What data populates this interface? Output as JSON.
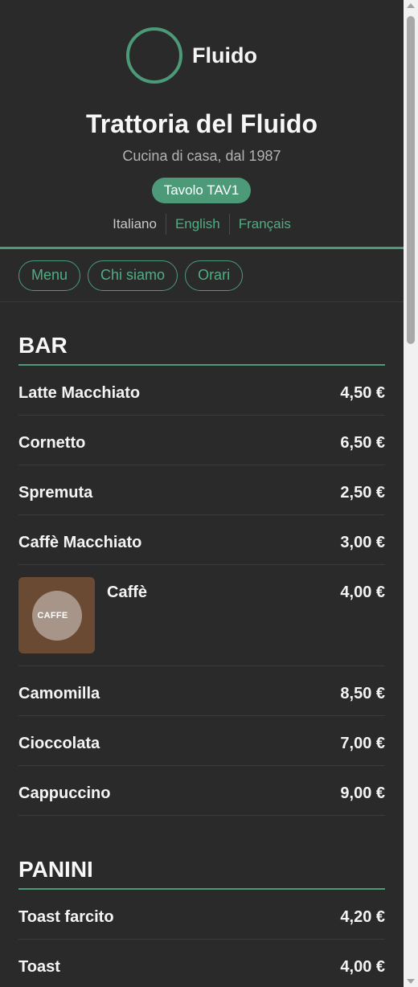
{
  "brand": {
    "name": "Fluido",
    "accent": "#4c9a78"
  },
  "header": {
    "title": "Trattoria del Fluido",
    "subtitle": "Cucina di casa, dal 1987",
    "table_badge": "Tavolo TAV1",
    "languages": [
      "Italiano",
      "English",
      "Français"
    ],
    "active_language": "Italiano"
  },
  "nav": {
    "items": [
      "Menu",
      "Chi siamo",
      "Orari"
    ]
  },
  "menu": {
    "sections": [
      {
        "title": "BAR",
        "items": [
          {
            "name": "Latte Macchiato",
            "price": "4,50 €"
          },
          {
            "name": "Cornetto",
            "price": "6,50 €"
          },
          {
            "name": "Spremuta",
            "price": "2,50 €"
          },
          {
            "name": "Caffè Macchiato",
            "price": "3,00 €"
          },
          {
            "name": "Caffè",
            "price": "4,00 €",
            "image_label": "CAFFE"
          },
          {
            "name": "Camomilla",
            "price": "8,50 €"
          },
          {
            "name": "Cioccolata",
            "price": "7,00 €"
          },
          {
            "name": "Cappuccino",
            "price": "9,00 €"
          }
        ]
      },
      {
        "title": "PANINI",
        "items": [
          {
            "name": "Toast farcito",
            "price": "4,20 €"
          },
          {
            "name": "Toast",
            "price": "4,00 €"
          }
        ]
      }
    ]
  }
}
